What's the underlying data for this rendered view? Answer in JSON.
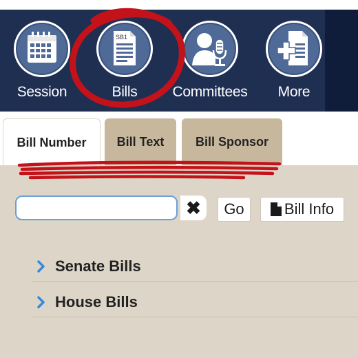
{
  "nav": {
    "items": [
      {
        "label": "Session",
        "icon": "calendar-icon"
      },
      {
        "label": "Bills",
        "icon": "bill-document-icon",
        "icon_text": "SB1"
      },
      {
        "label": "Committees",
        "icon": "committee-speaker-icon"
      },
      {
        "label": "More",
        "icon": "add-document-icon"
      }
    ]
  },
  "tabs": [
    {
      "label": "Bill Number",
      "active": true
    },
    {
      "label": "Bill Text",
      "active": false
    },
    {
      "label": "Bill Sponsor",
      "active": false
    }
  ],
  "search": {
    "value": "",
    "placeholder": "",
    "clear_icon": "✖"
  },
  "buttons": {
    "go": "Go",
    "bill_info": "Bill Info"
  },
  "list": [
    {
      "label": "Senate Bills"
    },
    {
      "label": "House Bills"
    }
  ],
  "colors": {
    "nav_bg": "#1f2f52",
    "tab_inactive": "#c7b89d",
    "panel_bg": "#ddd5c8",
    "annotation_red": "#c4121a",
    "chevron_blue": "#3a88d6"
  }
}
